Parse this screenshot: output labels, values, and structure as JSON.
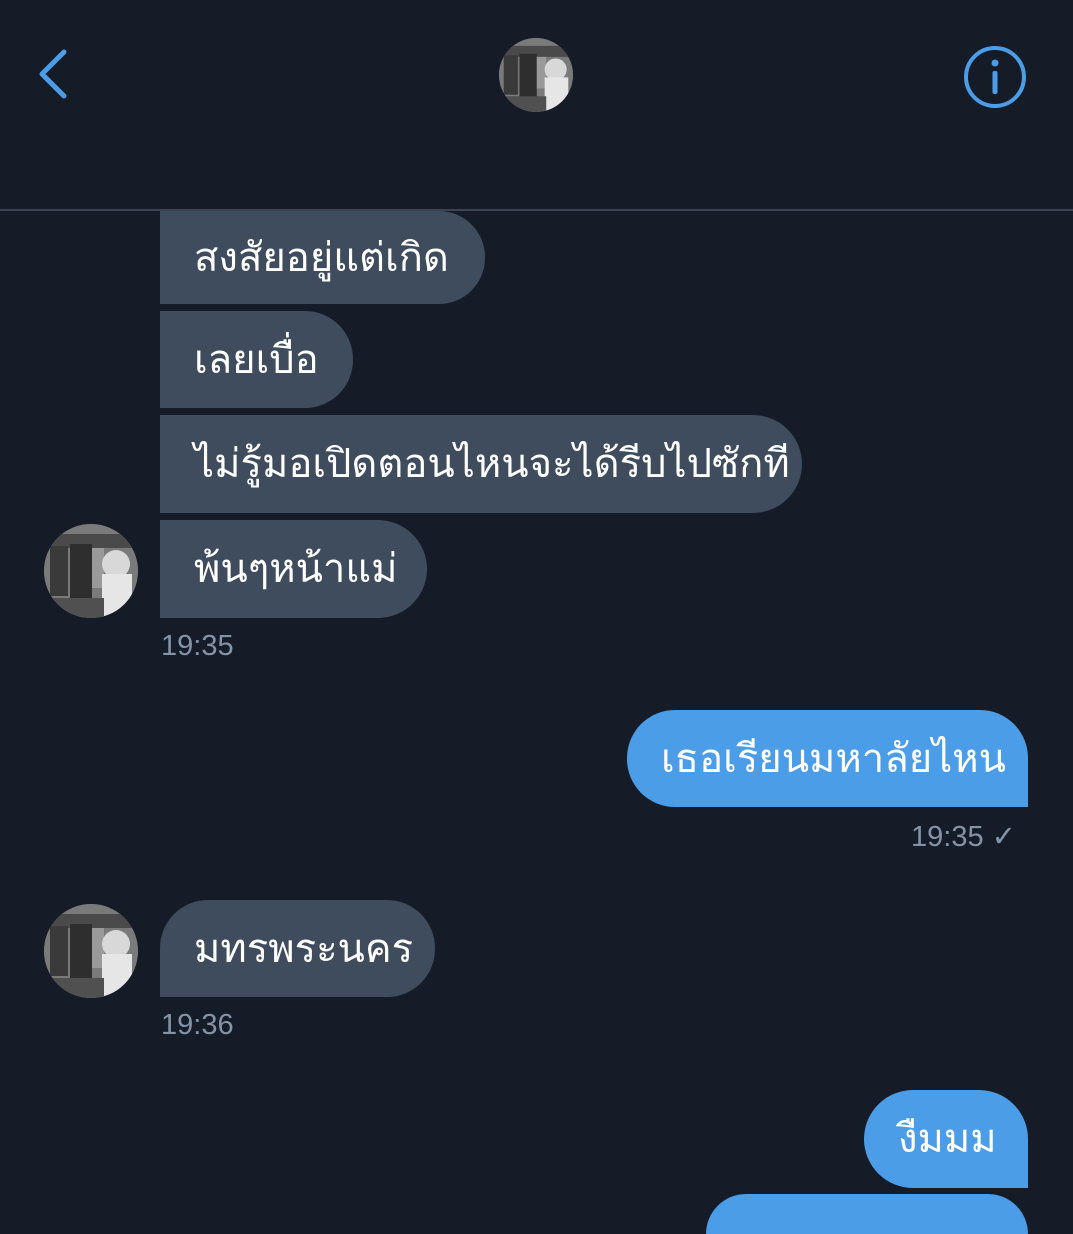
{
  "header": {
    "back_icon": "chevron-left-icon",
    "info_icon": "info-icon",
    "accent_color": "#4b9de7"
  },
  "conversation": {
    "group1": {
      "messages": [
        "สงสัยอยู่แต่เกิด",
        "เลยเบื่อ",
        "ไม่รู้มอเปิดตอนไหนจะได้รีบไปซักที",
        "พ้นๆหน้าแม่"
      ],
      "time": "19:35"
    },
    "group2": {
      "messages": [
        "เธอเรียนมหาลัยไหน"
      ],
      "time": "19:35",
      "read_icon": "checkmark-icon",
      "check_glyph": "✓"
    },
    "group3": {
      "messages": [
        "มทรพระนคร"
      ],
      "time": "19:36"
    },
    "group4": {
      "messages": [
        "งืมมม"
      ]
    }
  },
  "colors": {
    "background": "#151c28",
    "incoming_bubble": "#3e4c5d",
    "outgoing_bubble": "#4b9de7",
    "timestamp": "#8494a7"
  }
}
